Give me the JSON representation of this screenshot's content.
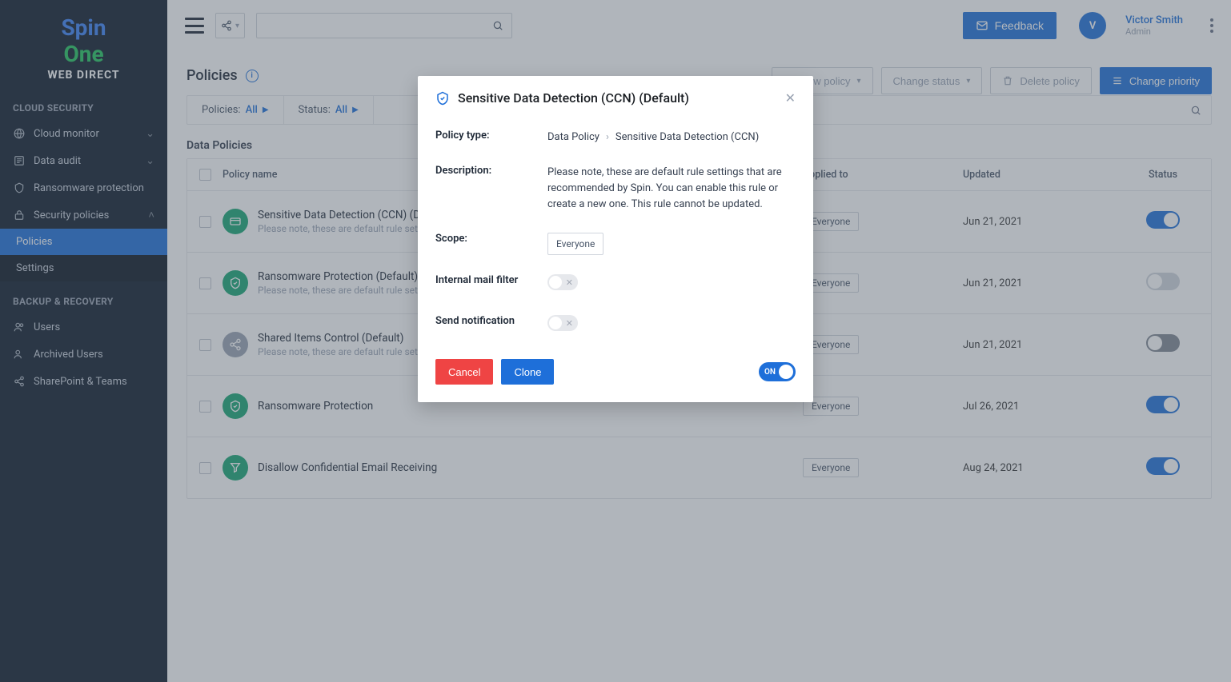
{
  "brand": {
    "line1a": "Spin",
    "line2": "One",
    "sub": "WEB DIRECT"
  },
  "sidebar": {
    "section1": "CLOUD SECURITY",
    "items1": [
      {
        "label": "Cloud monitor",
        "icon": "globe",
        "expand": true
      },
      {
        "label": "Data audit",
        "icon": "list",
        "expand": true
      },
      {
        "label": "Ransomware protection",
        "icon": "shield",
        "expand": false
      },
      {
        "label": "Security policies",
        "icon": "lock",
        "expand": true,
        "open": true
      }
    ],
    "subitems": [
      {
        "label": "Policies",
        "active": true
      },
      {
        "label": "Settings",
        "active": false
      }
    ],
    "section2": "BACKUP & RECOVERY",
    "items2": [
      {
        "label": "Users",
        "icon": "users"
      },
      {
        "label": "Archived Users",
        "icon": "users"
      },
      {
        "label": "SharePoint & Teams",
        "icon": "share"
      }
    ]
  },
  "topbar": {
    "feedback": "Feedback",
    "user": {
      "name": "Victor Smith",
      "role": "Admin",
      "initial": "V"
    }
  },
  "page": {
    "title": "Policies",
    "filters": [
      {
        "label": "Policies:",
        "value": "All"
      },
      {
        "label": "Status:",
        "value": "All"
      }
    ],
    "actions": {
      "new": "New policy",
      "change": "Change status",
      "delete": "Delete policy",
      "priority": "Change priority"
    },
    "section": "Data Policies",
    "columns": {
      "name": "Policy name",
      "applied": "Applied to",
      "updated": "Updated",
      "status": "Status"
    },
    "rows": [
      {
        "name": "Sensitive Data Detection (CCN) (Default)",
        "desc": "Please note, these are default rule settings that are recommended by Spin.",
        "icon": "ccn",
        "applied": "Everyone",
        "updated": "Jun 21, 2021",
        "on": true
      },
      {
        "name": "Ransomware Protection (Default)",
        "desc": "Please note, these are default rule settings that are recommended by Spin.",
        "icon": "shield",
        "applied": "Everyone",
        "updated": "Jun 21, 2021",
        "on": false
      },
      {
        "name": "Shared Items Control (Default)",
        "desc": "Please note, these are default rule settings that are recommended by Spin.",
        "icon": "share",
        "applied": "Everyone",
        "updated": "Jun 21, 2021",
        "on": false,
        "dark": true
      },
      {
        "name": "Ransomware Protection",
        "desc": "",
        "icon": "shield",
        "applied": "Everyone",
        "updated": "Jul 26, 2021",
        "on": true
      },
      {
        "name": "Disallow Confidential Email Receiving",
        "desc": "",
        "icon": "filter",
        "applied": "Everyone",
        "updated": "Aug 24, 2021",
        "on": true
      }
    ]
  },
  "modal": {
    "title": "Sensitive Data Detection (CCN) (Default)",
    "labels": {
      "type": "Policy type:",
      "desc": "Description:",
      "scope": "Scope:",
      "mail": "Internal mail filter",
      "notif": "Send notification"
    },
    "type_crumb": [
      "Data Policy",
      "Sensitive Data Detection (CCN)"
    ],
    "description": "Please note, these are default rule settings that are recommended by Spin. You can enable this rule or create a new one. This rule cannot be updated.",
    "scope": "Everyone",
    "buttons": {
      "cancel": "Cancel",
      "clone": "Clone"
    },
    "switch": "ON"
  }
}
